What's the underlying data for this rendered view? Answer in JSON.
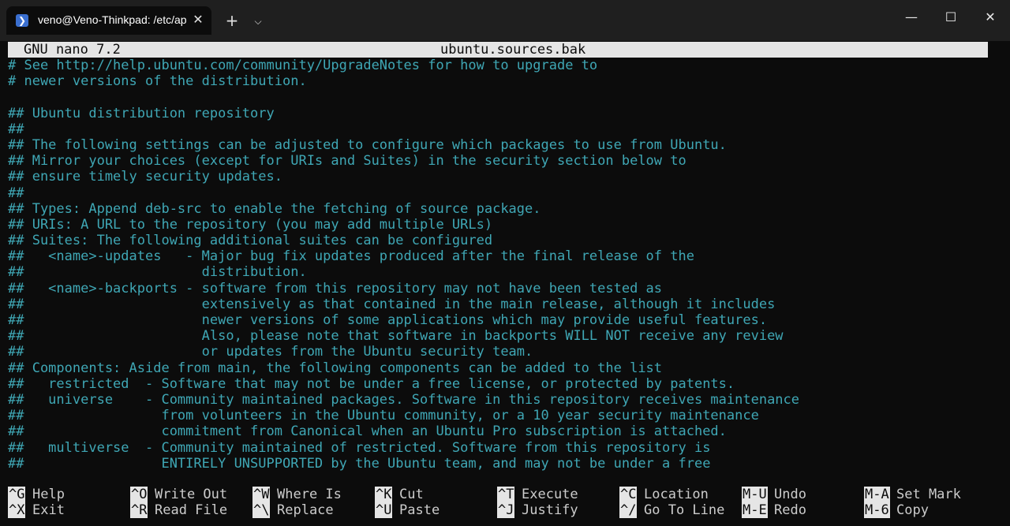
{
  "window": {
    "tab_title": "veno@Veno-Thinkpad: /etc/apt",
    "tab_icon": "powershell-icon",
    "close_tab_glyph": "✕",
    "new_tab_glyph": "+",
    "dropdown_glyph": "⌵",
    "minimize_glyph": "—",
    "maximize_glyph": "☐",
    "close_glyph": "✕"
  },
  "nano": {
    "version": "GNU nano 7.2",
    "filename": "ubuntu.sources.bak",
    "text_color": "#3fa7b5",
    "lines": [
      "# See http://help.ubuntu.com/community/UpgradeNotes for how to upgrade to",
      "# newer versions of the distribution.",
      "",
      "## Ubuntu distribution repository",
      "##",
      "## The following settings can be adjusted to configure which packages to use from Ubuntu.",
      "## Mirror your choices (except for URIs and Suites) in the security section below to",
      "## ensure timely security updates.",
      "##",
      "## Types: Append deb-src to enable the fetching of source package.",
      "## URIs: A URL to the repository (you may add multiple URLs)",
      "## Suites: The following additional suites can be configured",
      "##   <name>-updates   - Major bug fix updates produced after the final release of the",
      "##                      distribution.",
      "##   <name>-backports - software from this repository may not have been tested as",
      "##                      extensively as that contained in the main release, although it includes",
      "##                      newer versions of some applications which may provide useful features.",
      "##                      Also, please note that software in backports WILL NOT receive any review",
      "##                      or updates from the Ubuntu security team.",
      "## Components: Aside from main, the following components can be added to the list",
      "##   restricted  - Software that may not be under a free license, or protected by patents.",
      "##   universe    - Community maintained packages. Software in this repository receives maintenance",
      "##                 from volunteers in the Ubuntu community, or a 10 year security maintenance",
      "##                 commitment from Canonical when an Ubuntu Pro subscription is attached.",
      "##   multiverse  - Community maintained of restricted. Software from this repository is",
      "##                 ENTIRELY UNSUPPORTED by the Ubuntu team, and may not be under a free"
    ]
  },
  "shortcuts": {
    "row1": [
      {
        "key": "^G",
        "label": "Help"
      },
      {
        "key": "^O",
        "label": "Write Out"
      },
      {
        "key": "^W",
        "label": "Where Is"
      },
      {
        "key": "^K",
        "label": "Cut"
      },
      {
        "key": "^T",
        "label": "Execute"
      },
      {
        "key": "^C",
        "label": "Location"
      },
      {
        "key": "M-U",
        "label": "Undo"
      },
      {
        "key": "M-A",
        "label": "Set Mark"
      }
    ],
    "row2": [
      {
        "key": "^X",
        "label": "Exit"
      },
      {
        "key": "^R",
        "label": "Read File"
      },
      {
        "key": "^\\",
        "label": "Replace"
      },
      {
        "key": "^U",
        "label": "Paste"
      },
      {
        "key": "^J",
        "label": "Justify"
      },
      {
        "key": "^/",
        "label": "Go To Line"
      },
      {
        "key": "M-E",
        "label": "Redo"
      },
      {
        "key": "M-6",
        "label": "Copy"
      }
    ]
  }
}
